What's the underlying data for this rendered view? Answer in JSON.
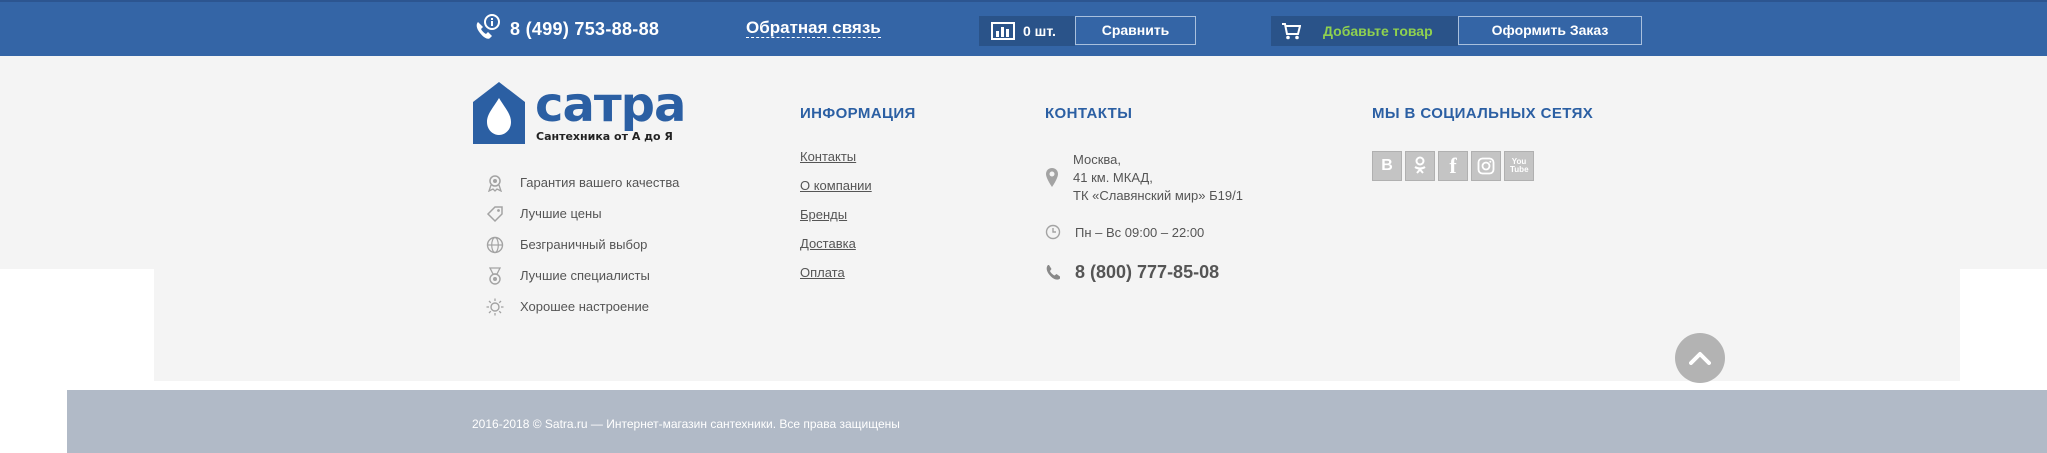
{
  "topbar": {
    "phone": "8 (499) 753-88-88",
    "feedback": "Обратная связь",
    "compare_count": "0 шт.",
    "compare_button": "Сравнить",
    "cart_text": "Добавьте товар",
    "order_button": "Оформить Заказ"
  },
  "brand": {
    "name": "сатра",
    "tagline": "Сантехника от А до Я",
    "color": "#2b5fa3"
  },
  "features": [
    {
      "icon": "badge-icon",
      "label": "Гарантия вашего качества"
    },
    {
      "icon": "tag-icon",
      "label": "Лучшие цены"
    },
    {
      "icon": "globe-icon",
      "label": "Безграничный выбор"
    },
    {
      "icon": "medal-icon",
      "label": "Лучшие специалисты"
    },
    {
      "icon": "sun-icon",
      "label": "Хорошее настроение"
    }
  ],
  "info": {
    "title": "ИНФОРМАЦИЯ",
    "links": [
      "Контакты",
      "О компании",
      "Бренды",
      "Доставка",
      "Оплата"
    ]
  },
  "contacts": {
    "title": "КОНТАКТЫ",
    "address_lines": [
      "Москва,",
      "41 км. МКАД,",
      "ТК «Славянский мир» Б19/1"
    ],
    "hours": "Пн – Вс 09:00 – 22:00",
    "phone": "8 (800) 777-85-08"
  },
  "social": {
    "title": "МЫ В СОЦИАЛЬНЫХ СЕТЯХ",
    "items": [
      {
        "icon": "vk-icon",
        "glyph": "В"
      },
      {
        "icon": "odnoklassniki-icon",
        "glyph": "ok"
      },
      {
        "icon": "facebook-icon",
        "glyph": "f"
      },
      {
        "icon": "instagram-icon",
        "glyph": "◎"
      },
      {
        "icon": "youtube-icon",
        "glyph": "You Tube"
      }
    ]
  },
  "footer": {
    "copyright": "2016-2018 © Satra.ru — Интернет-магазин сантехники. Все права защищены"
  },
  "colors": {
    "topbar": "#3465a6",
    "accent_green": "#8fd14f",
    "bottombar": "#b1bac7"
  }
}
